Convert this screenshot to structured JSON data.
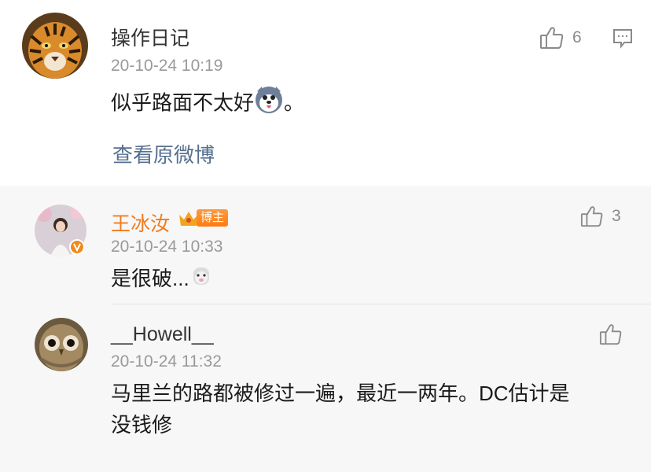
{
  "main_comment": {
    "username": "操作日记",
    "timestamp": "20-10-24 10:19",
    "text": "似乎路面不太好",
    "text_suffix": "。",
    "like_count": "6",
    "view_original_label": "查看原微博"
  },
  "replies": [
    {
      "username": "王冰汝",
      "badge": "博主",
      "timestamp": "20-10-24 10:33",
      "text": "是很破...",
      "like_count": "3"
    },
    {
      "username": "__Howell__",
      "timestamp": "20-10-24 11:32",
      "text_line1": "马里兰的路都被修过一遍，最近一两年。DC估计是",
      "text_line2": "没钱修",
      "like_count": ""
    }
  ],
  "colors": {
    "link": "#55708f",
    "badge_orange": "#ff7c12",
    "highlight_name": "#f07c1f",
    "reply_bg": "#f7f7f7"
  },
  "icons": [
    "tiger-avatar",
    "thumb-up-icon",
    "comment-icon",
    "husky-emoji",
    "verified-icon",
    "crown-icon",
    "owl-avatar",
    "sheep-emoji"
  ]
}
